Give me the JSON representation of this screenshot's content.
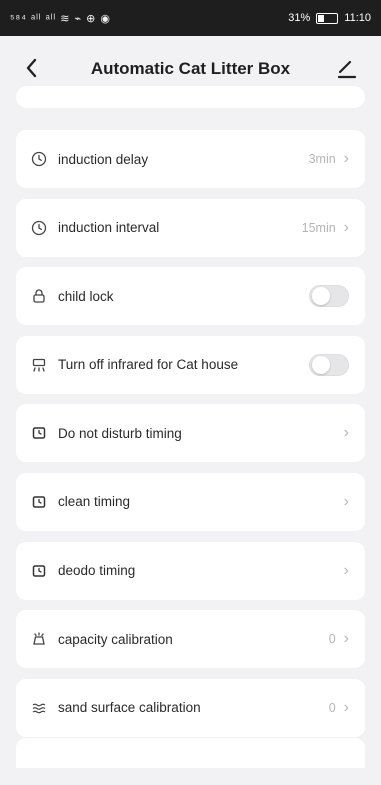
{
  "statusbar": {
    "left_text": "⁵⁸⁴ ᵃˡˡ ᵃˡˡ ≋ ⌁ ⊕ ◉",
    "battery_text": "31%",
    "time": "11:10"
  },
  "header": {
    "title": "Automatic Cat Litter Box"
  },
  "settings": [
    {
      "label": "induction delay",
      "value": "3min",
      "icon": "clock-icon"
    },
    {
      "label": "induction interval",
      "value": "15min",
      "icon": "clock-icon"
    },
    {
      "label": "child lock",
      "icon": "lock-icon",
      "toggle": false
    },
    {
      "label": "Turn off infrared for Cat house",
      "icon": "infrared-icon",
      "toggle": false
    },
    {
      "label": "Do not disturb timing",
      "icon": "alarm-icon"
    },
    {
      "label": "clean timing",
      "icon": "alarm-icon"
    },
    {
      "label": "deodo timing",
      "icon": "alarm-icon"
    },
    {
      "label": "capacity calibration",
      "value": "0",
      "icon": "calibration-icon"
    },
    {
      "label": "sand surface calibration",
      "value": "0",
      "icon": "waves-icon"
    }
  ]
}
